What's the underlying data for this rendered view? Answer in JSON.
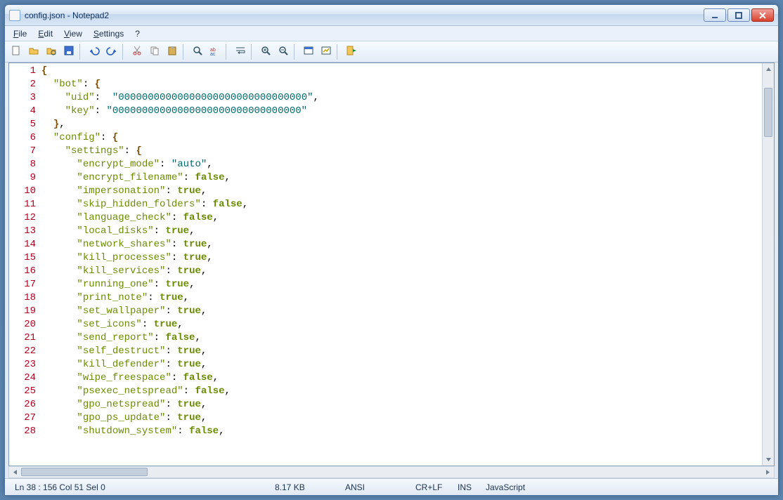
{
  "window": {
    "title": "config.json - Notepad2"
  },
  "menus": [
    "File",
    "Edit",
    "View",
    "Settings",
    "?"
  ],
  "toolbar_icons": [
    "new",
    "open",
    "browse",
    "save",
    "sep",
    "undo",
    "redo",
    "sep",
    "cut",
    "copy",
    "paste",
    "sep",
    "find",
    "replace",
    "sep",
    "wordwrap",
    "sep",
    "zoom-in",
    "zoom-out",
    "sep",
    "scheme",
    "customize",
    "sep",
    "exit"
  ],
  "code": {
    "lines": [
      [
        {
          "t": "brace",
          "v": "{"
        }
      ],
      [
        {
          "t": "plain",
          "v": "  "
        },
        {
          "t": "key",
          "v": "\"bot\""
        },
        {
          "t": "colon",
          "v": ": "
        },
        {
          "t": "brace",
          "v": "{"
        }
      ],
      [
        {
          "t": "plain",
          "v": "    "
        },
        {
          "t": "key",
          "v": "\"uid\""
        },
        {
          "t": "colon",
          "v": ":  "
        },
        {
          "t": "str",
          "v": "\"00000000000000000000000000000000\""
        },
        {
          "t": "plain",
          "v": ","
        }
      ],
      [
        {
          "t": "plain",
          "v": "    "
        },
        {
          "t": "key",
          "v": "\"key\""
        },
        {
          "t": "colon",
          "v": ": "
        },
        {
          "t": "str",
          "v": "\"00000000000000000000000000000000\""
        }
      ],
      [
        {
          "t": "plain",
          "v": "  "
        },
        {
          "t": "brace",
          "v": "}"
        },
        {
          "t": "plain",
          "v": ","
        }
      ],
      [
        {
          "t": "plain",
          "v": "  "
        },
        {
          "t": "key",
          "v": "\"config\""
        },
        {
          "t": "colon",
          "v": ": "
        },
        {
          "t": "brace",
          "v": "{"
        }
      ],
      [
        {
          "t": "plain",
          "v": "    "
        },
        {
          "t": "key",
          "v": "\"settings\""
        },
        {
          "t": "colon",
          "v": ": "
        },
        {
          "t": "brace",
          "v": "{"
        }
      ],
      [
        {
          "t": "plain",
          "v": "      "
        },
        {
          "t": "key",
          "v": "\"encrypt_mode\""
        },
        {
          "t": "colon",
          "v": ": "
        },
        {
          "t": "str",
          "v": "\"auto\""
        },
        {
          "t": "plain",
          "v": ","
        }
      ],
      [
        {
          "t": "plain",
          "v": "      "
        },
        {
          "t": "key",
          "v": "\"encrypt_filename\""
        },
        {
          "t": "colon",
          "v": ": "
        },
        {
          "t": "bool",
          "v": "false"
        },
        {
          "t": "plain",
          "v": ","
        }
      ],
      [
        {
          "t": "plain",
          "v": "      "
        },
        {
          "t": "key",
          "v": "\"impersonation\""
        },
        {
          "t": "colon",
          "v": ": "
        },
        {
          "t": "bool",
          "v": "true"
        },
        {
          "t": "plain",
          "v": ","
        }
      ],
      [
        {
          "t": "plain",
          "v": "      "
        },
        {
          "t": "key",
          "v": "\"skip_hidden_folders\""
        },
        {
          "t": "colon",
          "v": ": "
        },
        {
          "t": "bool",
          "v": "false"
        },
        {
          "t": "plain",
          "v": ","
        }
      ],
      [
        {
          "t": "plain",
          "v": "      "
        },
        {
          "t": "key",
          "v": "\"language_check\""
        },
        {
          "t": "colon",
          "v": ": "
        },
        {
          "t": "bool",
          "v": "false"
        },
        {
          "t": "plain",
          "v": ","
        }
      ],
      [
        {
          "t": "plain",
          "v": "      "
        },
        {
          "t": "key",
          "v": "\"local_disks\""
        },
        {
          "t": "colon",
          "v": ": "
        },
        {
          "t": "bool",
          "v": "true"
        },
        {
          "t": "plain",
          "v": ","
        }
      ],
      [
        {
          "t": "plain",
          "v": "      "
        },
        {
          "t": "key",
          "v": "\"network_shares\""
        },
        {
          "t": "colon",
          "v": ": "
        },
        {
          "t": "bool",
          "v": "true"
        },
        {
          "t": "plain",
          "v": ","
        }
      ],
      [
        {
          "t": "plain",
          "v": "      "
        },
        {
          "t": "key",
          "v": "\"kill_processes\""
        },
        {
          "t": "colon",
          "v": ": "
        },
        {
          "t": "bool",
          "v": "true"
        },
        {
          "t": "plain",
          "v": ","
        }
      ],
      [
        {
          "t": "plain",
          "v": "      "
        },
        {
          "t": "key",
          "v": "\"kill_services\""
        },
        {
          "t": "colon",
          "v": ": "
        },
        {
          "t": "bool",
          "v": "true"
        },
        {
          "t": "plain",
          "v": ","
        }
      ],
      [
        {
          "t": "plain",
          "v": "      "
        },
        {
          "t": "key",
          "v": "\"running_one\""
        },
        {
          "t": "colon",
          "v": ": "
        },
        {
          "t": "bool",
          "v": "true"
        },
        {
          "t": "plain",
          "v": ","
        }
      ],
      [
        {
          "t": "plain",
          "v": "      "
        },
        {
          "t": "key",
          "v": "\"print_note\""
        },
        {
          "t": "colon",
          "v": ": "
        },
        {
          "t": "bool",
          "v": "true"
        },
        {
          "t": "plain",
          "v": ","
        }
      ],
      [
        {
          "t": "plain",
          "v": "      "
        },
        {
          "t": "key",
          "v": "\"set_wallpaper\""
        },
        {
          "t": "colon",
          "v": ": "
        },
        {
          "t": "bool",
          "v": "true"
        },
        {
          "t": "plain",
          "v": ","
        }
      ],
      [
        {
          "t": "plain",
          "v": "      "
        },
        {
          "t": "key",
          "v": "\"set_icons\""
        },
        {
          "t": "colon",
          "v": ": "
        },
        {
          "t": "bool",
          "v": "true"
        },
        {
          "t": "plain",
          "v": ","
        }
      ],
      [
        {
          "t": "plain",
          "v": "      "
        },
        {
          "t": "key",
          "v": "\"send_report\""
        },
        {
          "t": "colon",
          "v": ": "
        },
        {
          "t": "bool",
          "v": "false"
        },
        {
          "t": "plain",
          "v": ","
        }
      ],
      [
        {
          "t": "plain",
          "v": "      "
        },
        {
          "t": "key",
          "v": "\"self_destruct\""
        },
        {
          "t": "colon",
          "v": ": "
        },
        {
          "t": "bool",
          "v": "true"
        },
        {
          "t": "plain",
          "v": ","
        }
      ],
      [
        {
          "t": "plain",
          "v": "      "
        },
        {
          "t": "key",
          "v": "\"kill_defender\""
        },
        {
          "t": "colon",
          "v": ": "
        },
        {
          "t": "bool",
          "v": "true"
        },
        {
          "t": "plain",
          "v": ","
        }
      ],
      [
        {
          "t": "plain",
          "v": "      "
        },
        {
          "t": "key",
          "v": "\"wipe_freespace\""
        },
        {
          "t": "colon",
          "v": ": "
        },
        {
          "t": "bool",
          "v": "false"
        },
        {
          "t": "plain",
          "v": ","
        }
      ],
      [
        {
          "t": "plain",
          "v": "      "
        },
        {
          "t": "key",
          "v": "\"psexec_netspread\""
        },
        {
          "t": "colon",
          "v": ": "
        },
        {
          "t": "bool",
          "v": "false"
        },
        {
          "t": "plain",
          "v": ","
        }
      ],
      [
        {
          "t": "plain",
          "v": "      "
        },
        {
          "t": "key",
          "v": "\"gpo_netspread\""
        },
        {
          "t": "colon",
          "v": ": "
        },
        {
          "t": "bool",
          "v": "true"
        },
        {
          "t": "plain",
          "v": ","
        }
      ],
      [
        {
          "t": "plain",
          "v": "      "
        },
        {
          "t": "key",
          "v": "\"gpo_ps_update\""
        },
        {
          "t": "colon",
          "v": ": "
        },
        {
          "t": "bool",
          "v": "true"
        },
        {
          "t": "plain",
          "v": ","
        }
      ],
      [
        {
          "t": "plain",
          "v": "      "
        },
        {
          "t": "key",
          "v": "\"shutdown_system\""
        },
        {
          "t": "colon",
          "v": ": "
        },
        {
          "t": "bool",
          "v": "false"
        },
        {
          "t": "plain",
          "v": ","
        }
      ]
    ]
  },
  "status": {
    "pos": "Ln 38 : 156   Col 51   Sel 0",
    "size": "8.17 KB",
    "encoding": "ANSI",
    "eol": "CR+LF",
    "ins": "INS",
    "lang": "JavaScript"
  }
}
